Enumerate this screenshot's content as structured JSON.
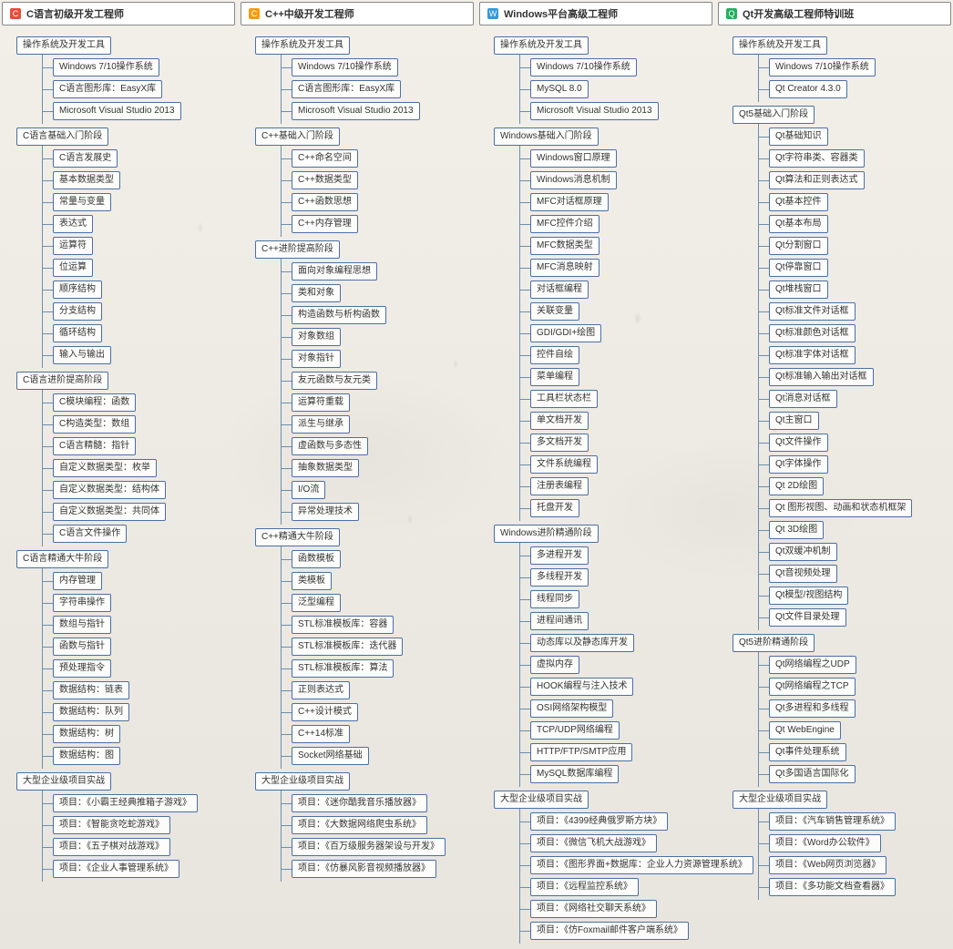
{
  "columns": [
    {
      "title": "C语言初级开发工程师",
      "icon": "C",
      "iconColor": "#e74c3c",
      "tree": [
        {
          "label": "操作系统及开发工具",
          "children": [
            {
              "label": "Windows 7/10操作系统"
            },
            {
              "label": "C语言图形库：EasyX库"
            },
            {
              "label": "Microsoft Visual Studio 2013"
            }
          ]
        },
        {
          "label": "C语言基础入门阶段",
          "children": [
            {
              "label": "C语言发展史"
            },
            {
              "label": "基本数据类型"
            },
            {
              "label": "常量与变量"
            },
            {
              "label": "表达式"
            },
            {
              "label": "运算符"
            },
            {
              "label": "位运算"
            },
            {
              "label": "顺序结构"
            },
            {
              "label": "分支结构"
            },
            {
              "label": "循环结构"
            },
            {
              "label": "输入与输出"
            }
          ]
        },
        {
          "label": "C语言进阶提高阶段",
          "children": [
            {
              "label": "C模块编程：函数"
            },
            {
              "label": "C构造类型：数组"
            },
            {
              "label": "C语言精髓：指针"
            },
            {
              "label": "自定义数据类型：枚举"
            },
            {
              "label": "自定义数据类型：结构体"
            },
            {
              "label": "自定义数据类型：共同体"
            },
            {
              "label": "C语言文件操作"
            }
          ]
        },
        {
          "label": "C语言精通大牛阶段",
          "children": [
            {
              "label": "内存管理"
            },
            {
              "label": "字符串操作"
            },
            {
              "label": "数组与指针"
            },
            {
              "label": "函数与指针"
            },
            {
              "label": "预处理指令"
            },
            {
              "label": "数据结构：链表"
            },
            {
              "label": "数据结构：队列"
            },
            {
              "label": "数据结构：树"
            },
            {
              "label": "数据结构：图"
            }
          ]
        },
        {
          "label": "大型企业级项目实战",
          "children": [
            {
              "label": "项目：《小霸王经典推箱子游戏》"
            },
            {
              "label": "项目：《智能贪吃蛇游戏》"
            },
            {
              "label": "项目：《五子棋对战游戏》"
            },
            {
              "label": "项目：《企业人事管理系统》"
            }
          ]
        }
      ]
    },
    {
      "title": "C++中级开发工程师",
      "icon": "C",
      "iconColor": "#f39c12",
      "tree": [
        {
          "label": "操作系统及开发工具",
          "children": [
            {
              "label": "Windows 7/10操作系统"
            },
            {
              "label": "C语言图形库：EasyX库"
            },
            {
              "label": "Microsoft Visual Studio 2013"
            }
          ]
        },
        {
          "label": "C++基础入门阶段",
          "children": [
            {
              "label": "C++命名空间"
            },
            {
              "label": "C++数据类型"
            },
            {
              "label": "C++函数思想"
            },
            {
              "label": "C++内存管理"
            }
          ]
        },
        {
          "label": "C++进阶提高阶段",
          "children": [
            {
              "label": "面向对象编程思想"
            },
            {
              "label": "类和对象"
            },
            {
              "label": "构造函数与析构函数"
            },
            {
              "label": "对象数组"
            },
            {
              "label": "对象指针"
            },
            {
              "label": "友元函数与友元类"
            },
            {
              "label": "运算符重载"
            },
            {
              "label": "派生与继承"
            },
            {
              "label": "虚函数与多态性"
            },
            {
              "label": "抽象数据类型"
            },
            {
              "label": "I/O流"
            },
            {
              "label": "异常处理技术"
            }
          ]
        },
        {
          "label": "C++精通大牛阶段",
          "children": [
            {
              "label": "函数模板"
            },
            {
              "label": "类模板"
            },
            {
              "label": "泛型编程"
            },
            {
              "label": "STL标准模板库：容器"
            },
            {
              "label": "STL标准模板库：迭代器"
            },
            {
              "label": "STL标准模板库：算法"
            },
            {
              "label": "正则表达式"
            },
            {
              "label": "C++设计模式"
            },
            {
              "label": "C++14标准"
            },
            {
              "label": "Socket网络基础"
            }
          ]
        },
        {
          "label": "大型企业级项目实战",
          "children": [
            {
              "label": "项目：《迷你酷我音乐播放器》"
            },
            {
              "label": "项目：《大数据网络爬虫系统》"
            },
            {
              "label": "项目：《百万级服务器架设与开发》"
            },
            {
              "label": "项目：《仿暴风影音视频播放器》"
            }
          ]
        }
      ]
    },
    {
      "title": "Windows平台高级工程师",
      "icon": "W",
      "iconColor": "#3498db",
      "tree": [
        {
          "label": "操作系统及开发工具",
          "children": [
            {
              "label": "Windows 7/10操作系统"
            },
            {
              "label": "MySQL 8.0"
            },
            {
              "label": "Microsoft Visual Studio 2013"
            }
          ]
        },
        {
          "label": "Windows基础入门阶段",
          "children": [
            {
              "label": "Windows窗口原理"
            },
            {
              "label": "Windows消息机制"
            },
            {
              "label": "MFC对话框原理"
            },
            {
              "label": "MFC控件介绍"
            },
            {
              "label": "MFC数据类型"
            },
            {
              "label": "MFC消息映射"
            },
            {
              "label": "对话框编程"
            },
            {
              "label": "关联变量"
            },
            {
              "label": "GDI/GDI+绘图"
            },
            {
              "label": "控件自绘"
            },
            {
              "label": "菜单编程"
            },
            {
              "label": "工具栏状态栏"
            },
            {
              "label": "单文档开发"
            },
            {
              "label": "多文档开发"
            },
            {
              "label": "文件系统编程"
            },
            {
              "label": "注册表编程"
            },
            {
              "label": "托盘开发"
            }
          ]
        },
        {
          "label": "Windows进阶精通阶段",
          "children": [
            {
              "label": "多进程开发"
            },
            {
              "label": "多线程开发"
            },
            {
              "label": "线程同步"
            },
            {
              "label": "进程间通讯"
            },
            {
              "label": "动态库以及静态库开发"
            },
            {
              "label": "虚拟内存"
            },
            {
              "label": "HOOK编程与注入技术"
            },
            {
              "label": "OSI网络架构模型"
            },
            {
              "label": "TCP/UDP网络编程"
            },
            {
              "label": "HTTP/FTP/SMTP应用"
            },
            {
              "label": "MySQL数据库编程"
            }
          ]
        },
        {
          "label": "大型企业级项目实战",
          "children": [
            {
              "label": "项目：《4399经典俄罗斯方块》"
            },
            {
              "label": "项目：《微信飞机大战游戏》"
            },
            {
              "label": "项目：《图形界面+数据库：企业人力资源管理系统》"
            },
            {
              "label": "项目：《远程监控系统》"
            },
            {
              "label": "项目：《网络社交聊天系统》"
            },
            {
              "label": "项目：《仿Foxmail邮件客户端系统》"
            }
          ]
        }
      ]
    },
    {
      "title": "Qt开发高级工程师特训班",
      "icon": "Q",
      "iconColor": "#27ae60",
      "tree": [
        {
          "label": "操作系统及开发工具",
          "children": [
            {
              "label": "Windows 7/10操作系统"
            },
            {
              "label": "Qt Creator 4.3.0"
            }
          ]
        },
        {
          "label": "Qt5基础入门阶段",
          "children": [
            {
              "label": "Qt基础知识"
            },
            {
              "label": "Qt字符串类、容器类"
            },
            {
              "label": "Qt算法和正则表达式"
            },
            {
              "label": "Qt基本控件"
            },
            {
              "label": "Qt基本布局"
            },
            {
              "label": "Qt分割窗口"
            },
            {
              "label": "Qt停靠窗口"
            },
            {
              "label": "Qt堆栈窗口"
            },
            {
              "label": "Qt标准文件对话框"
            },
            {
              "label": "Qt标准颜色对话框"
            },
            {
              "label": "Qt标准字体对话框"
            },
            {
              "label": "Qt标准输入输出对话框"
            },
            {
              "label": "Qt消息对话框"
            },
            {
              "label": "Qt主窗口"
            },
            {
              "label": "Qt文件操作"
            },
            {
              "label": "Qt字体操作"
            },
            {
              "label": "Qt 2D绘图"
            },
            {
              "label": "Qt 图形视图、动画和状态机框架"
            },
            {
              "label": "Qt 3D绘图"
            },
            {
              "label": "Qt双缓冲机制"
            },
            {
              "label": "Qt音视频处理"
            },
            {
              "label": "Qt模型/视图结构"
            },
            {
              "label": "Qt文件目录处理"
            }
          ]
        },
        {
          "label": "Qt5进阶精通阶段",
          "children": [
            {
              "label": "Qt网络编程之UDP"
            },
            {
              "label": "Qt网络编程之TCP"
            },
            {
              "label": "Qt多进程和多线程"
            },
            {
              "label": "Qt WebEngine"
            },
            {
              "label": "Qt事件处理系统"
            },
            {
              "label": "Qt多国语言国际化"
            }
          ]
        },
        {
          "label": "大型企业级项目实战",
          "children": [
            {
              "label": "项目：《汽车销售管理系统》"
            },
            {
              "label": "项目：《Word办公软件》"
            },
            {
              "label": "项目：《Web网页浏览器》"
            },
            {
              "label": "项目：《多功能文档查看器》"
            }
          ]
        }
      ]
    }
  ]
}
